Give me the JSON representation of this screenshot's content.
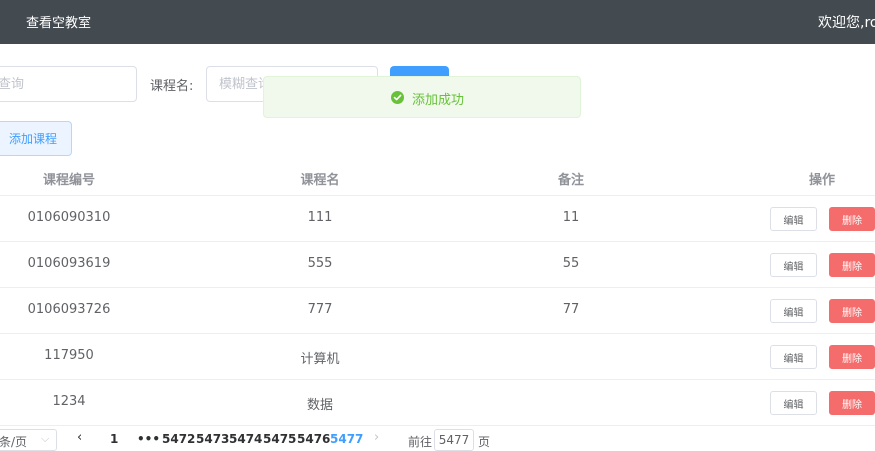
{
  "header": {
    "nav_title": "查看空教室",
    "welcome": "欢迎您,ro"
  },
  "search": {
    "id_placeholder": "查询",
    "name_label": "课程名:",
    "name_placeholder": "模糊查询",
    "search_label": ""
  },
  "toolbar": {
    "add_label": "添加课程"
  },
  "toast": {
    "message": "添加成功",
    "icon": "check-circle-icon",
    "color": "#67c23a"
  },
  "table": {
    "columns": [
      "课程编号",
      "课程名",
      "备注",
      "操作"
    ],
    "rows": [
      {
        "id": "0106090310",
        "name": "111",
        "note": "11"
      },
      {
        "id": "0106093619",
        "name": "555",
        "note": "55"
      },
      {
        "id": "0106093726",
        "name": "777",
        "note": "77"
      },
      {
        "id": "117950",
        "name": "计算机",
        "note": ""
      },
      {
        "id": "1234",
        "name": "数据",
        "note": ""
      }
    ],
    "edit_label": "编辑",
    "delete_label": "删除"
  },
  "pagination": {
    "page_size_label": "条/页",
    "prev": "‹",
    "next": "›",
    "pages": [
      "1",
      "•••",
      "5472",
      "5473",
      "5474",
      "5475",
      "5476",
      "5477"
    ],
    "current": "5477",
    "goto_label": "前往",
    "goto_value": "5477",
    "goto_suffix": "页"
  },
  "colors": {
    "header_bg": "#434a50",
    "primary": "#409eff",
    "danger": "#f56c6c",
    "success": "#67c23a"
  }
}
